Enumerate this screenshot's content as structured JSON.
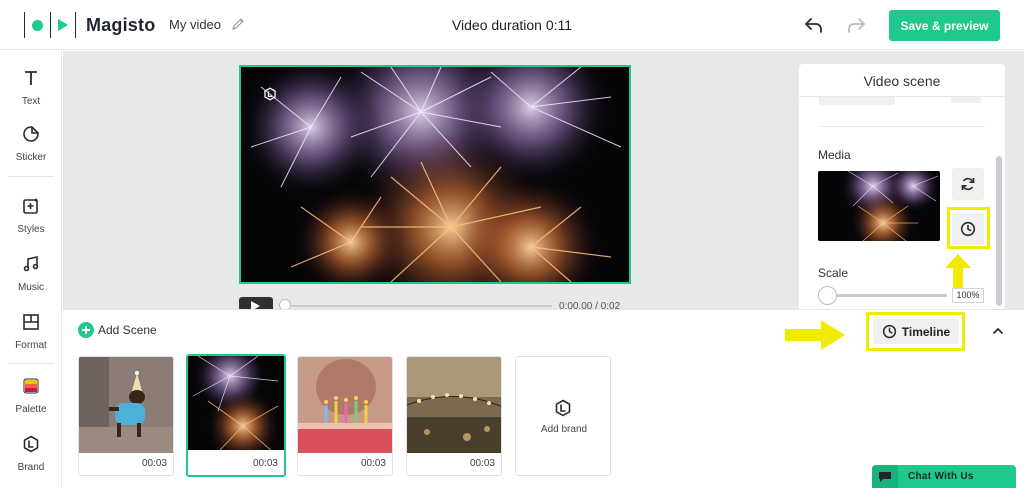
{
  "header": {
    "brand": "Magisto",
    "project_name": "My video",
    "duration": "Video duration 0:11",
    "save_label": "Save & preview"
  },
  "sidebar": {
    "items": [
      {
        "label": "Text",
        "icon": "text-icon"
      },
      {
        "label": "Sticker",
        "icon": "sticker-icon"
      },
      {
        "label": "Styles",
        "icon": "styles-icon"
      },
      {
        "label": "Music",
        "icon": "music-icon"
      },
      {
        "label": "Format",
        "icon": "format-icon"
      },
      {
        "label": "Palette",
        "icon": "palette-icon"
      },
      {
        "label": "Brand",
        "icon": "brand-icon"
      }
    ]
  },
  "player": {
    "time": "0:00.00 / 0:02"
  },
  "panel": {
    "title": "Video scene",
    "media_label": "Media",
    "scale_label": "Scale",
    "scale_value": "100%",
    "scale_fraction": 0.0
  },
  "bottom": {
    "add_scene_label": "Add Scene",
    "timeline_label": "Timeline",
    "scenes": [
      {
        "duration": "00:03",
        "subject": "dog",
        "selected": false
      },
      {
        "duration": "00:03",
        "subject": "fireworks",
        "selected": true
      },
      {
        "duration": "00:03",
        "subject": "birthday-cake",
        "selected": false
      },
      {
        "duration": "00:03",
        "subject": "string-lights",
        "selected": false
      }
    ],
    "add_brand_label": "Add brand"
  },
  "chat": {
    "label": "Chat With Us"
  },
  "colors": {
    "accent": "#1fc98c",
    "highlight": "#f2ea00"
  }
}
